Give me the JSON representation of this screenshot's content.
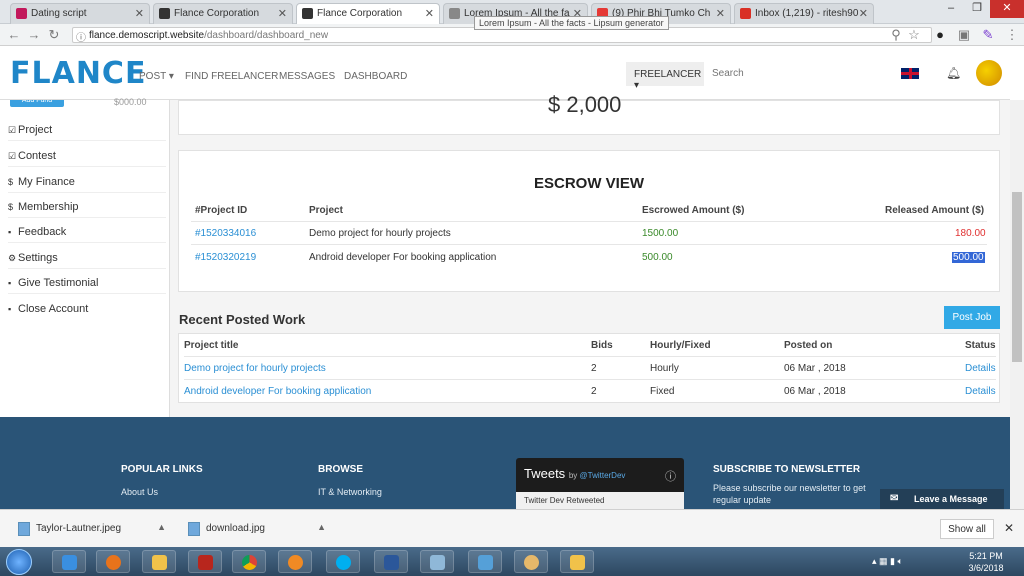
{
  "browser": {
    "tabs": [
      {
        "title": "Dating script",
        "favicon_color": "#c2185b",
        "active": false
      },
      {
        "title": "Flance Corporation",
        "favicon_color": "#333333",
        "active": false
      },
      {
        "title": "Flance Corporation",
        "favicon_color": "#333333",
        "active": true
      },
      {
        "title": "Lorem Ipsum - All the fa",
        "favicon_color": "#888888",
        "active": false
      },
      {
        "title": "(9) Phir Bhi Tumko Ch",
        "favicon_color": "#e53935",
        "active": false
      },
      {
        "title": "Inbox (1,219) - ritesh90",
        "favicon_color": "#d93025",
        "active": false
      }
    ],
    "tooltip": "Lorem Ipsum - All the facts - Lipsum generator",
    "url_host": "flance.demoscript.website",
    "url_path": "/dashboard/dashboard_new",
    "close_glyph": "✕"
  },
  "header": {
    "logo": "FLANCE",
    "nav": [
      "POST",
      "FIND FREELANCER",
      "MESSAGES",
      "DASHBOARD"
    ],
    "role": "FREELANCER",
    "search_placeholder": "Search"
  },
  "sidebar": {
    "add_funds": "Add Fund",
    "balance": "$000.00",
    "items": [
      {
        "icon": "☑",
        "label": "Project"
      },
      {
        "icon": "☑",
        "label": "Contest"
      },
      {
        "icon": "$",
        "label": "My Finance"
      },
      {
        "icon": "$",
        "label": "Membership"
      },
      {
        "icon": "▪",
        "label": "Feedback"
      },
      {
        "icon": "⚙",
        "label": "Settings"
      },
      {
        "icon": "▪",
        "label": "Give Testimonial"
      },
      {
        "icon": "▪",
        "label": "Close Account"
      }
    ]
  },
  "summary": {
    "amount": "$ 2,000"
  },
  "escrow": {
    "title": "ESCROW VIEW",
    "headers": [
      "#Project ID",
      "Project",
      "Escrowed Amount ($)",
      "Released Amount ($)"
    ],
    "rows": [
      {
        "id": "#1520334016",
        "project": "Demo project for hourly projects",
        "escrowed": "1500.00",
        "released": "180.00"
      },
      {
        "id": "#1520320219",
        "project": "Android developer For booking application",
        "escrowed": "500.00",
        "released": "500.00"
      }
    ]
  },
  "recent": {
    "title": "Recent Posted Work",
    "post_job": "Post Job",
    "headers": [
      "Project title",
      "Bids",
      "Hourly/Fixed",
      "Posted on",
      "Status"
    ],
    "rows": [
      {
        "title": "Demo project for hourly projects",
        "bids": "2",
        "type": "Hourly",
        "posted": "06 Mar , 2018",
        "status": "Details"
      },
      {
        "title": "Android developer For booking application",
        "bids": "2",
        "type": "Fixed",
        "posted": "06 Mar , 2018",
        "status": "Details"
      }
    ]
  },
  "footer": {
    "popular_links": "POPULAR LINKS",
    "about_us": "About Us",
    "browse": "BROWSE",
    "it_networking": "IT & Networking",
    "tweets_title": "Tweets",
    "tweets_by": "by",
    "tweets_handle": "@TwitterDev",
    "tweets_sub": "Twitter Dev Retweeted",
    "subscribe_title": "SUBSCRIBE TO NEWSLETTER",
    "subscribe_text": "Please subscribe our newsletter to get regular update",
    "leave_message": "Leave a Message"
  },
  "downloads": {
    "items": [
      "Taylor-Lautner.jpeg",
      "download.jpg"
    ],
    "show_all": "Show all"
  },
  "taskbar": {
    "time": "5:21 PM",
    "date": "3/6/2018"
  },
  "watermark": "flance",
  "colors": {
    "accent": "#31a9e6",
    "footer": "#2a5477",
    "link": "#2a8fd4"
  }
}
